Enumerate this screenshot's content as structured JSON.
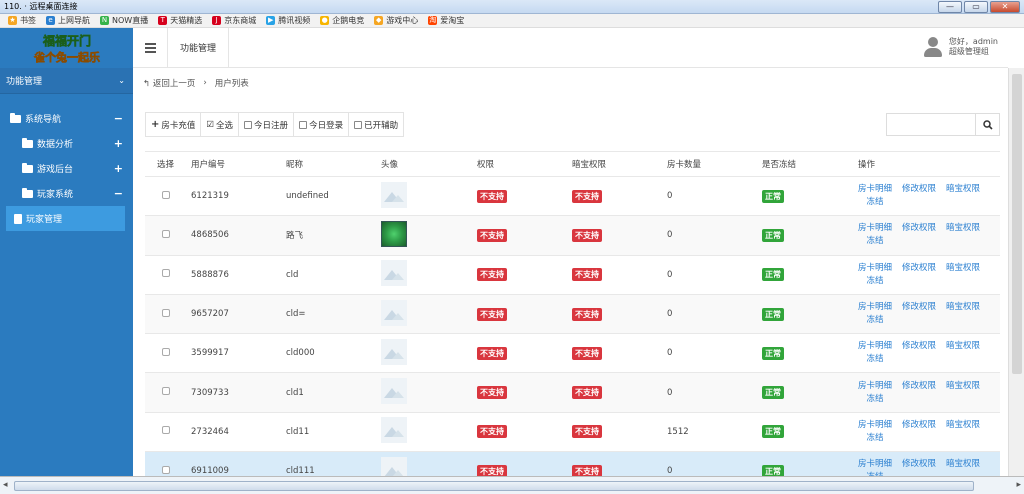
{
  "window": {
    "title": "110.          · 远程桌面连接",
    "controls": {
      "minimize": "—",
      "restore": "▭",
      "close": "✕"
    }
  },
  "bookmarks": [
    {
      "label": "书签",
      "icon": "star-icon",
      "color": "#f5a623"
    },
    {
      "label": "上网导航",
      "icon": "ie-icon",
      "color": "#2a7fd0"
    },
    {
      "label": "NOW直播",
      "icon": "now-icon",
      "color": "#36b34a"
    },
    {
      "label": "天猫精选",
      "icon": "tmall-icon",
      "color": "#d6001c"
    },
    {
      "label": "京东商城",
      "icon": "jd-icon",
      "color": "#d6001c"
    },
    {
      "label": "腾讯视频",
      "icon": "video-icon",
      "color": "#29a3e6"
    },
    {
      "label": "企鹅电竞",
      "icon": "penguin-icon",
      "color": "#f7b500"
    },
    {
      "label": "游戏中心",
      "icon": "game-icon",
      "color": "#f5a623"
    },
    {
      "label": "爱淘宝",
      "icon": "taobao-icon",
      "color": "#ff4400"
    }
  ],
  "sidebar": {
    "logo_line1": "福福开门",
    "logo_line2": "雀个兔一起乐",
    "menu_title": "功能管理",
    "sections": [
      {
        "label": "系统导航",
        "toggle": "−"
      },
      {
        "label": "数据分析",
        "toggle": "+"
      },
      {
        "label": "游戏后台",
        "toggle": "+"
      },
      {
        "label": "玩家系统",
        "toggle": "−"
      }
    ],
    "active_item": "玩家管理"
  },
  "header": {
    "tab": "功能管理",
    "greeting": "您好，admin",
    "role": "超级管理组"
  },
  "breadcrumb": {
    "back": "返回上一页",
    "separator": "›",
    "current": "用户列表"
  },
  "toolbar": {
    "recharge": "房卡充值",
    "select_all": "全选",
    "today_register": "今日注册",
    "today_login": "今日登录",
    "assist_enabled": "已开辅助"
  },
  "search": {
    "placeholder": ""
  },
  "table": {
    "headers": [
      "选择",
      "用户编号",
      "昵称",
      "头像",
      "权限",
      "暗宝权限",
      "房卡数量",
      "是否冻结",
      "操作"
    ],
    "rows": [
      {
        "id": "6121319",
        "nick": "undefined",
        "avatar": "placeholder",
        "perm": "不支持",
        "bao": "不支持",
        "cards": "0",
        "frozen": "正常"
      },
      {
        "id": "4868506",
        "nick": "路飞",
        "avatar": "photo",
        "perm": "不支持",
        "bao": "不支持",
        "cards": "0",
        "frozen": "正常"
      },
      {
        "id": "5888876",
        "nick": "cld",
        "avatar": "placeholder",
        "perm": "不支持",
        "bao": "不支持",
        "cards": "0",
        "frozen": "正常"
      },
      {
        "id": "9657207",
        "nick": "cld=",
        "avatar": "placeholder",
        "perm": "不支持",
        "bao": "不支持",
        "cards": "0",
        "frozen": "正常"
      },
      {
        "id": "3599917",
        "nick": "cld000",
        "avatar": "placeholder",
        "perm": "不支持",
        "bao": "不支持",
        "cards": "0",
        "frozen": "正常"
      },
      {
        "id": "7309733",
        "nick": "cld1",
        "avatar": "placeholder",
        "perm": "不支持",
        "bao": "不支持",
        "cards": "0",
        "frozen": "正常"
      },
      {
        "id": "2732464",
        "nick": "cld11",
        "avatar": "placeholder",
        "perm": "不支持",
        "bao": "不支持",
        "cards": "1512",
        "frozen": "正常"
      },
      {
        "id": "6911009",
        "nick": "cld111",
        "avatar": "placeholder",
        "perm": "不支持",
        "bao": "不支持",
        "cards": "0",
        "frozen": "正常"
      }
    ],
    "ops": {
      "card_detail": "房卡明细",
      "freeze": "冻结",
      "edit_perm": "修改权限",
      "bao_perm": "暗宝权限"
    }
  },
  "colors": {
    "sidebar": "#2b7bbf",
    "danger": "#d9363e",
    "success": "#31a53a",
    "link": "#2a7fd0"
  }
}
